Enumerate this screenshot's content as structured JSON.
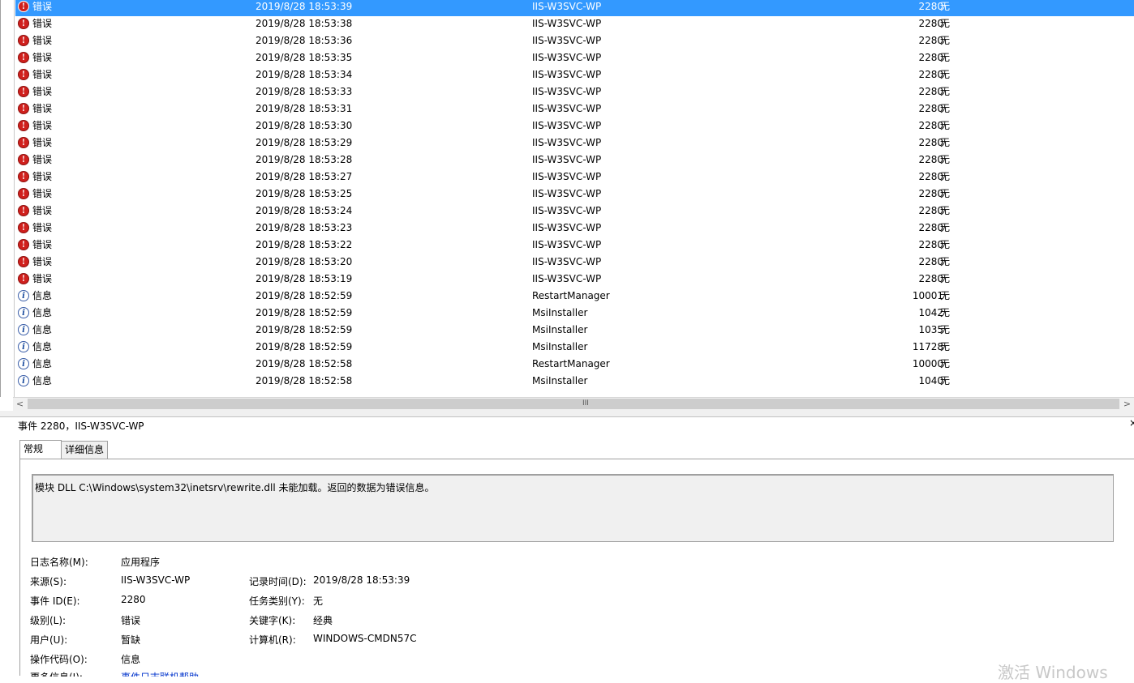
{
  "events": [
    {
      "level": "错误",
      "type": "error",
      "datetime": "2019/8/28 18:53:39",
      "source": "IIS-W3SVC-WP",
      "event_id": "2280",
      "category": "无",
      "selected": true
    },
    {
      "level": "错误",
      "type": "error",
      "datetime": "2019/8/28 18:53:38",
      "source": "IIS-W3SVC-WP",
      "event_id": "2280",
      "category": "无"
    },
    {
      "level": "错误",
      "type": "error",
      "datetime": "2019/8/28 18:53:36",
      "source": "IIS-W3SVC-WP",
      "event_id": "2280",
      "category": "无"
    },
    {
      "level": "错误",
      "type": "error",
      "datetime": "2019/8/28 18:53:35",
      "source": "IIS-W3SVC-WP",
      "event_id": "2280",
      "category": "无"
    },
    {
      "level": "错误",
      "type": "error",
      "datetime": "2019/8/28 18:53:34",
      "source": "IIS-W3SVC-WP",
      "event_id": "2280",
      "category": "无"
    },
    {
      "level": "错误",
      "type": "error",
      "datetime": "2019/8/28 18:53:33",
      "source": "IIS-W3SVC-WP",
      "event_id": "2280",
      "category": "无"
    },
    {
      "level": "错误",
      "type": "error",
      "datetime": "2019/8/28 18:53:31",
      "source": "IIS-W3SVC-WP",
      "event_id": "2280",
      "category": "无"
    },
    {
      "level": "错误",
      "type": "error",
      "datetime": "2019/8/28 18:53:30",
      "source": "IIS-W3SVC-WP",
      "event_id": "2280",
      "category": "无"
    },
    {
      "level": "错误",
      "type": "error",
      "datetime": "2019/8/28 18:53:29",
      "source": "IIS-W3SVC-WP",
      "event_id": "2280",
      "category": "无"
    },
    {
      "level": "错误",
      "type": "error",
      "datetime": "2019/8/28 18:53:28",
      "source": "IIS-W3SVC-WP",
      "event_id": "2280",
      "category": "无"
    },
    {
      "level": "错误",
      "type": "error",
      "datetime": "2019/8/28 18:53:27",
      "source": "IIS-W3SVC-WP",
      "event_id": "2280",
      "category": "无"
    },
    {
      "level": "错误",
      "type": "error",
      "datetime": "2019/8/28 18:53:25",
      "source": "IIS-W3SVC-WP",
      "event_id": "2280",
      "category": "无"
    },
    {
      "level": "错误",
      "type": "error",
      "datetime": "2019/8/28 18:53:24",
      "source": "IIS-W3SVC-WP",
      "event_id": "2280",
      "category": "无"
    },
    {
      "level": "错误",
      "type": "error",
      "datetime": "2019/8/28 18:53:23",
      "source": "IIS-W3SVC-WP",
      "event_id": "2280",
      "category": "无"
    },
    {
      "level": "错误",
      "type": "error",
      "datetime": "2019/8/28 18:53:22",
      "source": "IIS-W3SVC-WP",
      "event_id": "2280",
      "category": "无"
    },
    {
      "level": "错误",
      "type": "error",
      "datetime": "2019/8/28 18:53:20",
      "source": "IIS-W3SVC-WP",
      "event_id": "2280",
      "category": "无"
    },
    {
      "level": "错误",
      "type": "error",
      "datetime": "2019/8/28 18:53:19",
      "source": "IIS-W3SVC-WP",
      "event_id": "2280",
      "category": "无"
    },
    {
      "level": "信息",
      "type": "info",
      "datetime": "2019/8/28 18:52:59",
      "source": "RestartManager",
      "event_id": "10001",
      "category": "无"
    },
    {
      "level": "信息",
      "type": "info",
      "datetime": "2019/8/28 18:52:59",
      "source": "MsiInstaller",
      "event_id": "1042",
      "category": "无"
    },
    {
      "level": "信息",
      "type": "info",
      "datetime": "2019/8/28 18:52:59",
      "source": "MsiInstaller",
      "event_id": "1035",
      "category": "无"
    },
    {
      "level": "信息",
      "type": "info",
      "datetime": "2019/8/28 18:52:59",
      "source": "MsiInstaller",
      "event_id": "11728",
      "category": "无"
    },
    {
      "level": "信息",
      "type": "info",
      "datetime": "2019/8/28 18:52:58",
      "source": "RestartManager",
      "event_id": "10000",
      "category": "无"
    },
    {
      "level": "信息",
      "type": "info",
      "datetime": "2019/8/28 18:52:58",
      "source": "MsiInstaller",
      "event_id": "1040",
      "category": "无"
    }
  ],
  "icons": {
    "error": "error-icon",
    "info": "info-icon"
  },
  "scrollbar": {
    "left": "<",
    "right": ">",
    "grip": "III"
  },
  "detail": {
    "title": "事件 2280，IIS-W3SVC-WP",
    "close": "×",
    "tabs": {
      "general": "常规",
      "details": "详细信息"
    },
    "message": "模块 DLL C:\\Windows\\system32\\inetsrv\\rewrite.dll 未能加载。返回的数据为错误信息。",
    "fields": {
      "log_name_label": "日志名称(M):",
      "log_name": "应用程序",
      "source_label": "来源(S):",
      "source": "IIS-W3SVC-WP",
      "logged_label": "记录时间(D):",
      "logged": "2019/8/28 18:53:39",
      "event_id_label": "事件 ID(E):",
      "event_id": "2280",
      "task_label": "任务类别(Y):",
      "task": "无",
      "level_label": "级别(L):",
      "level": "错误",
      "keywords_label": "关键字(K):",
      "keywords": "经典",
      "user_label": "用户(U):",
      "user": "暂缺",
      "computer_label": "计算机(R):",
      "computer": "WINDOWS-CMDN57C",
      "opcode_label": "操作代码(O):",
      "opcode": "信息",
      "more_info_label": "更多信息(I):",
      "more_info": "事件日志联机帮助"
    }
  },
  "watermark": "激活 Windows",
  "colors": {
    "selection": "#3399ff",
    "error": "#d0201d",
    "info": "#3a5ea8",
    "link": "#0033cc"
  }
}
